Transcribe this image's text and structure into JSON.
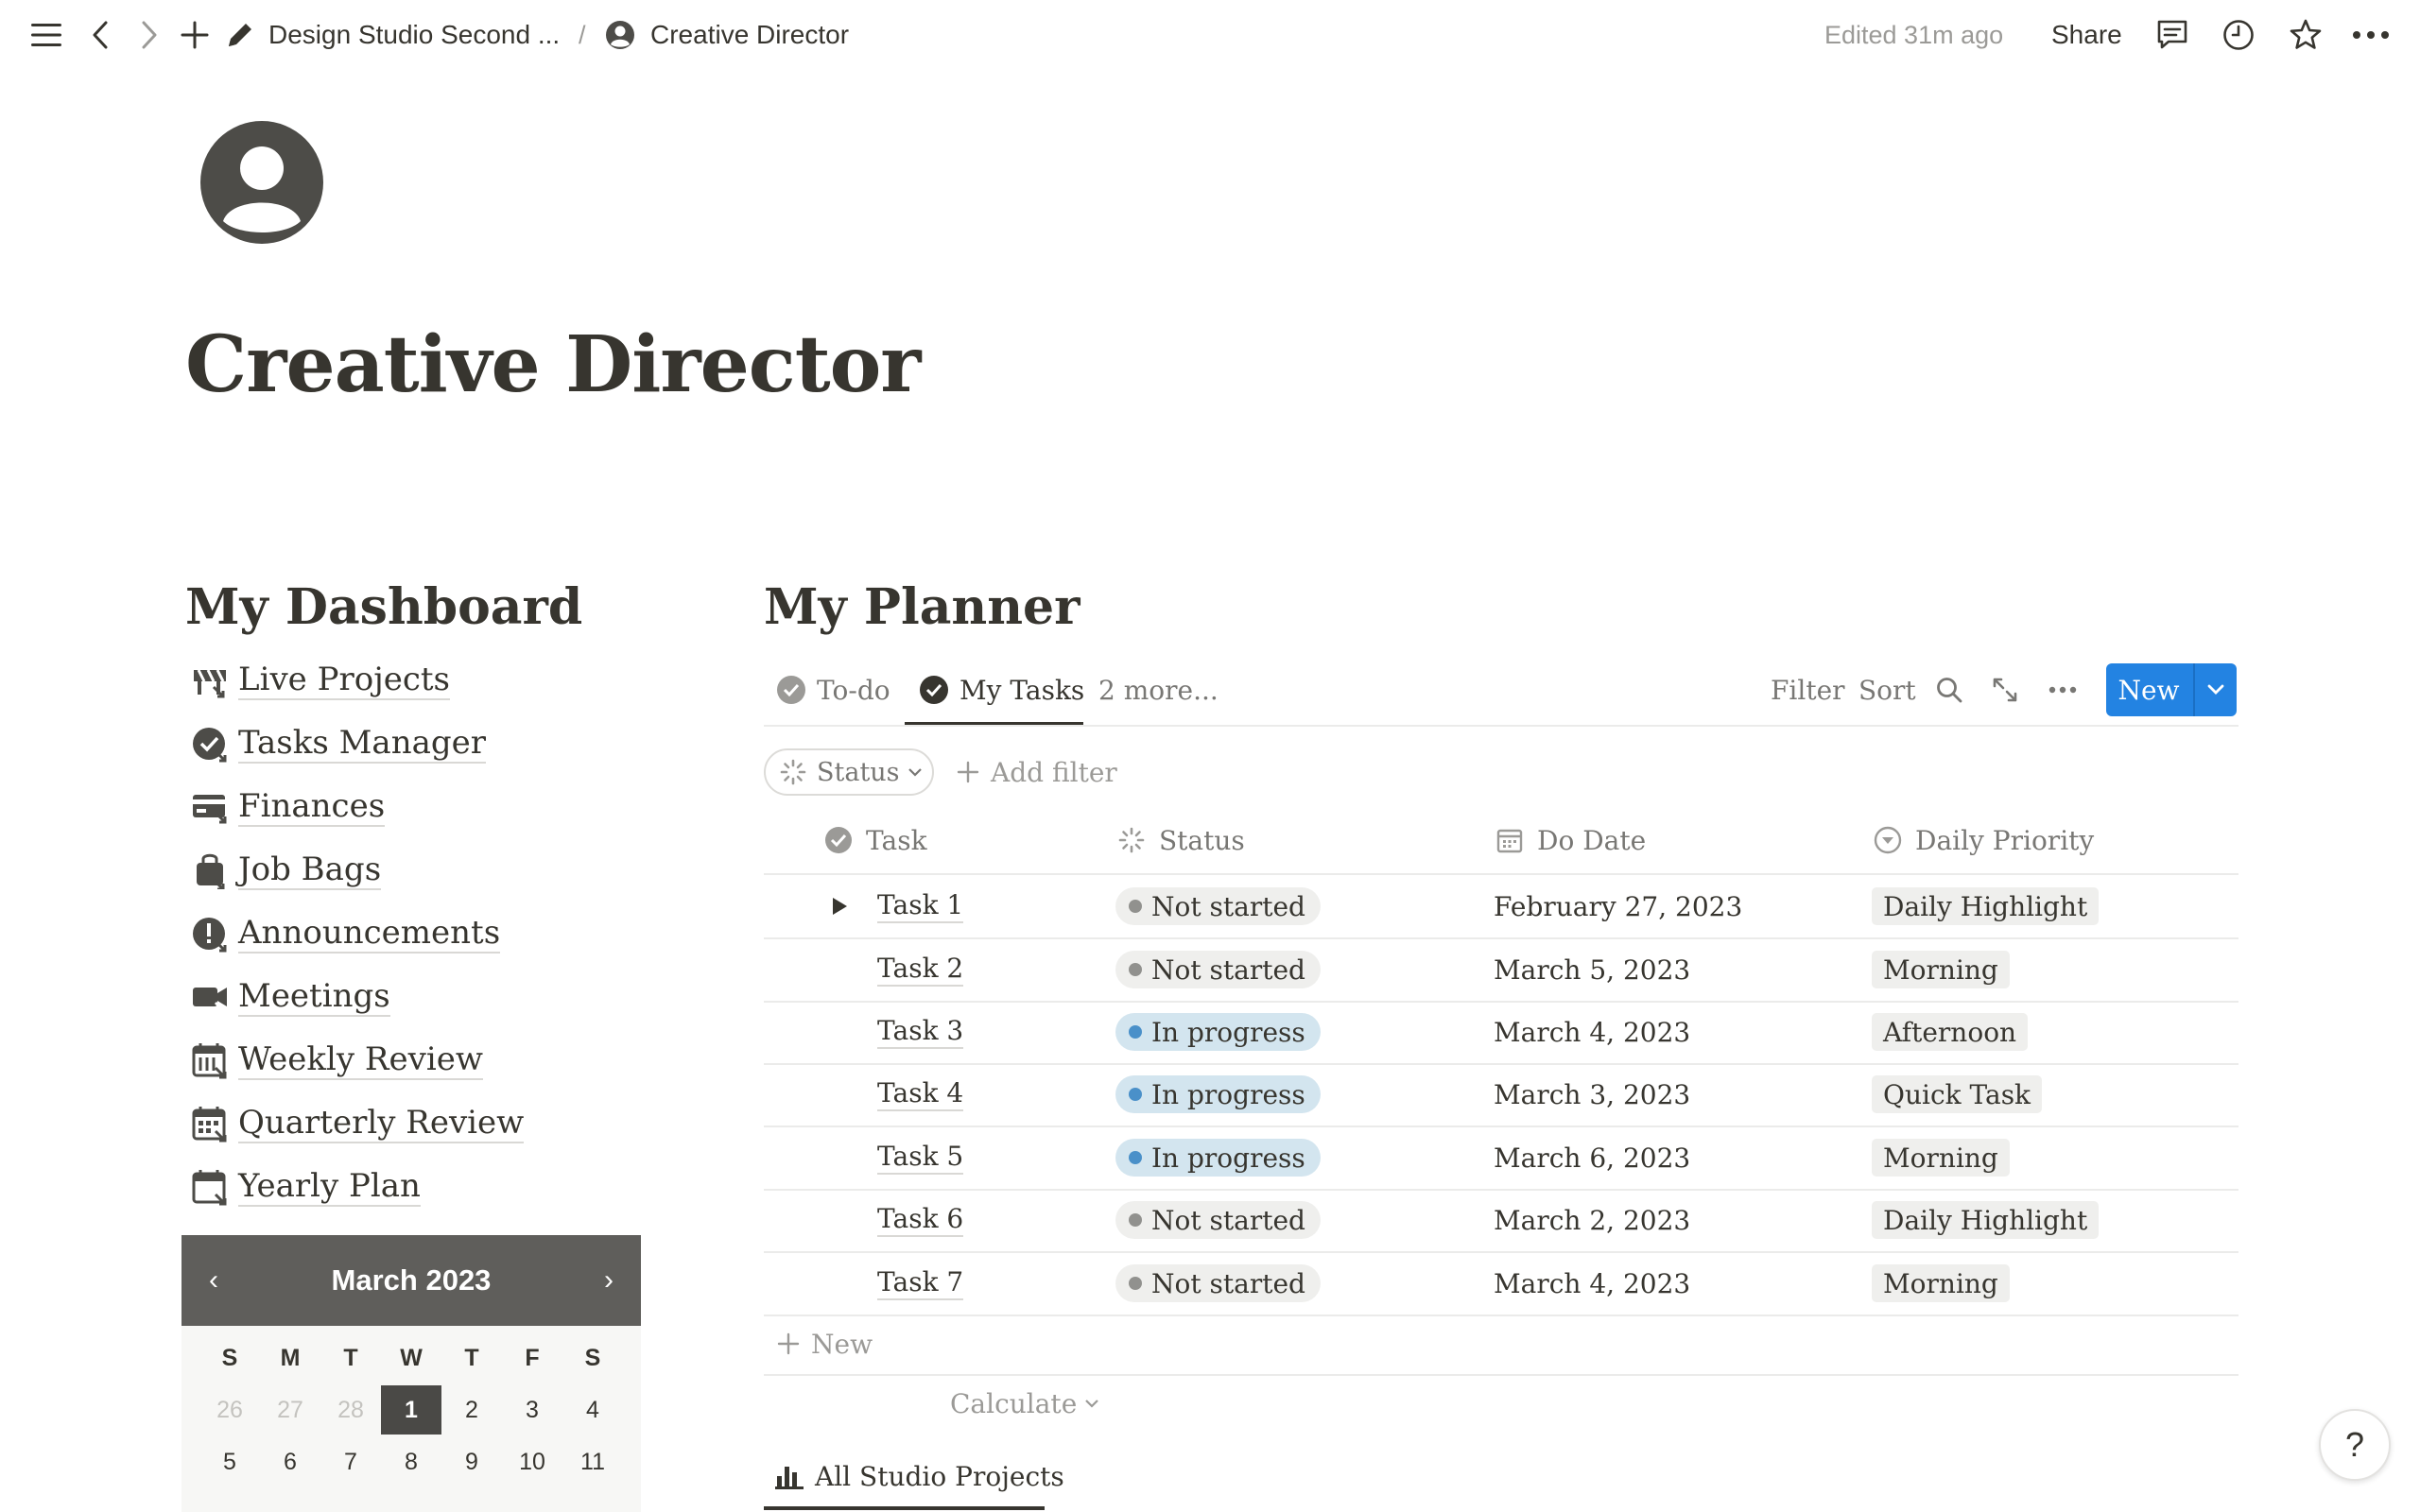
{
  "topbar": {
    "breadcrumb_parent": "Design Studio Second ...",
    "breadcrumb_sep": "/",
    "breadcrumb_current": "Creative Director",
    "edited": "Edited 31m ago",
    "share": "Share"
  },
  "page": {
    "title": "Creative Director"
  },
  "dashboard": {
    "heading": "My Dashboard",
    "items": [
      {
        "label": "Live Projects",
        "icon": "road-barrier-icon"
      },
      {
        "label": "Tasks Manager",
        "icon": "check-circle-icon"
      },
      {
        "label": "Finances",
        "icon": "credit-card-icon"
      },
      {
        "label": "Job Bags",
        "icon": "bag-icon"
      },
      {
        "label": "Announcements",
        "icon": "alert-circle-icon"
      },
      {
        "label": "Meetings",
        "icon": "video-camera-icon"
      },
      {
        "label": "Weekly Review",
        "icon": "calendar-week-icon"
      },
      {
        "label": "Quarterly Review",
        "icon": "calendar-grid-icon"
      },
      {
        "label": "Yearly Plan",
        "icon": "calendar-icon"
      }
    ]
  },
  "calendar": {
    "title": "March 2023",
    "prev": "‹",
    "next": "›",
    "weekdays": [
      "S",
      "M",
      "T",
      "W",
      "T",
      "F",
      "S"
    ],
    "row1": [
      "26",
      "27",
      "28",
      "1",
      "2",
      "3",
      "4"
    ],
    "row2": [
      "5",
      "6",
      "7",
      "8",
      "9",
      "10",
      "11"
    ],
    "today": "1"
  },
  "planner": {
    "heading": "My Planner",
    "tabs": [
      {
        "label": "To-do"
      },
      {
        "label": "My Tasks"
      },
      {
        "label": "2 more..."
      }
    ],
    "toolbar": {
      "filter": "Filter",
      "sort": "Sort",
      "new": "New"
    },
    "filter_pill": "Status",
    "add_filter": "Add filter",
    "columns": {
      "task": "Task",
      "status": "Status",
      "do_date": "Do Date",
      "priority": "Daily Priority"
    },
    "rows": [
      {
        "task": "Task 1",
        "status": "Not started",
        "date": "February 27, 2023",
        "priority": "Daily Highlight"
      },
      {
        "task": "Task 2",
        "status": "Not started",
        "date": "March 5, 2023",
        "priority": "Morning"
      },
      {
        "task": "Task 3",
        "status": "In progress",
        "date": "March 4, 2023",
        "priority": "Afternoon"
      },
      {
        "task": "Task 4",
        "status": "In progress",
        "date": "March 3, 2023",
        "priority": "Quick Task"
      },
      {
        "task": "Task 5",
        "status": "In progress",
        "date": "March 6, 2023",
        "priority": "Morning"
      },
      {
        "task": "Task 6",
        "status": "Not started",
        "date": "March 2, 2023",
        "priority": "Daily Highlight"
      },
      {
        "task": "Task 7",
        "status": "Not started",
        "date": "March 4, 2023",
        "priority": "Morning"
      }
    ],
    "add_new": "New",
    "calculate": "Calculate",
    "projects_tab": "All Studio Projects"
  },
  "help": "?",
  "colors": {
    "accent": "#2383e2",
    "not_started_bg": "#efefed",
    "not_started_dot": "#91918e",
    "in_progress_bg": "#d3e5ef",
    "in_progress_dot": "#4a90c9"
  }
}
